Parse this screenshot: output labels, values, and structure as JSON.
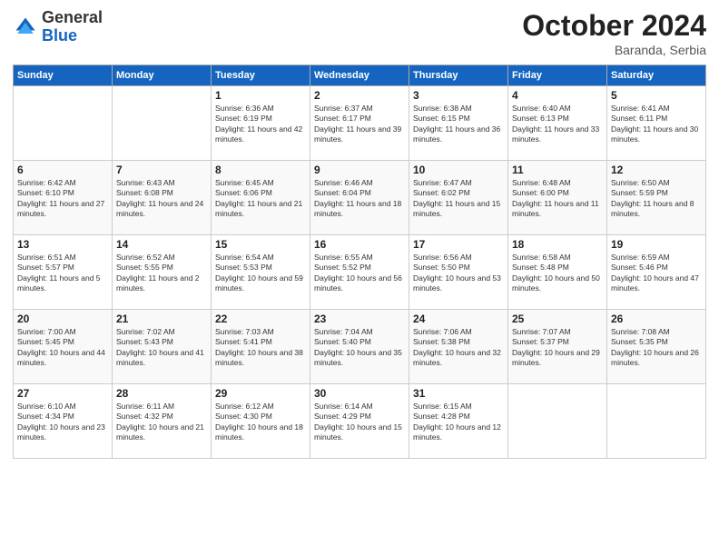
{
  "logo": {
    "general": "General",
    "blue": "Blue"
  },
  "header": {
    "month": "October 2024",
    "location": "Baranda, Serbia"
  },
  "days_of_week": [
    "Sunday",
    "Monday",
    "Tuesday",
    "Wednesday",
    "Thursday",
    "Friday",
    "Saturday"
  ],
  "weeks": [
    [
      {
        "day": "",
        "sunrise": "",
        "sunset": "",
        "daylight": ""
      },
      {
        "day": "",
        "sunrise": "",
        "sunset": "",
        "daylight": ""
      },
      {
        "day": "1",
        "sunrise": "Sunrise: 6:36 AM",
        "sunset": "Sunset: 6:19 PM",
        "daylight": "Daylight: 11 hours and 42 minutes."
      },
      {
        "day": "2",
        "sunrise": "Sunrise: 6:37 AM",
        "sunset": "Sunset: 6:17 PM",
        "daylight": "Daylight: 11 hours and 39 minutes."
      },
      {
        "day": "3",
        "sunrise": "Sunrise: 6:38 AM",
        "sunset": "Sunset: 6:15 PM",
        "daylight": "Daylight: 11 hours and 36 minutes."
      },
      {
        "day": "4",
        "sunrise": "Sunrise: 6:40 AM",
        "sunset": "Sunset: 6:13 PM",
        "daylight": "Daylight: 11 hours and 33 minutes."
      },
      {
        "day": "5",
        "sunrise": "Sunrise: 6:41 AM",
        "sunset": "Sunset: 6:11 PM",
        "daylight": "Daylight: 11 hours and 30 minutes."
      }
    ],
    [
      {
        "day": "6",
        "sunrise": "Sunrise: 6:42 AM",
        "sunset": "Sunset: 6:10 PM",
        "daylight": "Daylight: 11 hours and 27 minutes."
      },
      {
        "day": "7",
        "sunrise": "Sunrise: 6:43 AM",
        "sunset": "Sunset: 6:08 PM",
        "daylight": "Daylight: 11 hours and 24 minutes."
      },
      {
        "day": "8",
        "sunrise": "Sunrise: 6:45 AM",
        "sunset": "Sunset: 6:06 PM",
        "daylight": "Daylight: 11 hours and 21 minutes."
      },
      {
        "day": "9",
        "sunrise": "Sunrise: 6:46 AM",
        "sunset": "Sunset: 6:04 PM",
        "daylight": "Daylight: 11 hours and 18 minutes."
      },
      {
        "day": "10",
        "sunrise": "Sunrise: 6:47 AM",
        "sunset": "Sunset: 6:02 PM",
        "daylight": "Daylight: 11 hours and 15 minutes."
      },
      {
        "day": "11",
        "sunrise": "Sunrise: 6:48 AM",
        "sunset": "Sunset: 6:00 PM",
        "daylight": "Daylight: 11 hours and 11 minutes."
      },
      {
        "day": "12",
        "sunrise": "Sunrise: 6:50 AM",
        "sunset": "Sunset: 5:59 PM",
        "daylight": "Daylight: 11 hours and 8 minutes."
      }
    ],
    [
      {
        "day": "13",
        "sunrise": "Sunrise: 6:51 AM",
        "sunset": "Sunset: 5:57 PM",
        "daylight": "Daylight: 11 hours and 5 minutes."
      },
      {
        "day": "14",
        "sunrise": "Sunrise: 6:52 AM",
        "sunset": "Sunset: 5:55 PM",
        "daylight": "Daylight: 11 hours and 2 minutes."
      },
      {
        "day": "15",
        "sunrise": "Sunrise: 6:54 AM",
        "sunset": "Sunset: 5:53 PM",
        "daylight": "Daylight: 10 hours and 59 minutes."
      },
      {
        "day": "16",
        "sunrise": "Sunrise: 6:55 AM",
        "sunset": "Sunset: 5:52 PM",
        "daylight": "Daylight: 10 hours and 56 minutes."
      },
      {
        "day": "17",
        "sunrise": "Sunrise: 6:56 AM",
        "sunset": "Sunset: 5:50 PM",
        "daylight": "Daylight: 10 hours and 53 minutes."
      },
      {
        "day": "18",
        "sunrise": "Sunrise: 6:58 AM",
        "sunset": "Sunset: 5:48 PM",
        "daylight": "Daylight: 10 hours and 50 minutes."
      },
      {
        "day": "19",
        "sunrise": "Sunrise: 6:59 AM",
        "sunset": "Sunset: 5:46 PM",
        "daylight": "Daylight: 10 hours and 47 minutes."
      }
    ],
    [
      {
        "day": "20",
        "sunrise": "Sunrise: 7:00 AM",
        "sunset": "Sunset: 5:45 PM",
        "daylight": "Daylight: 10 hours and 44 minutes."
      },
      {
        "day": "21",
        "sunrise": "Sunrise: 7:02 AM",
        "sunset": "Sunset: 5:43 PM",
        "daylight": "Daylight: 10 hours and 41 minutes."
      },
      {
        "day": "22",
        "sunrise": "Sunrise: 7:03 AM",
        "sunset": "Sunset: 5:41 PM",
        "daylight": "Daylight: 10 hours and 38 minutes."
      },
      {
        "day": "23",
        "sunrise": "Sunrise: 7:04 AM",
        "sunset": "Sunset: 5:40 PM",
        "daylight": "Daylight: 10 hours and 35 minutes."
      },
      {
        "day": "24",
        "sunrise": "Sunrise: 7:06 AM",
        "sunset": "Sunset: 5:38 PM",
        "daylight": "Daylight: 10 hours and 32 minutes."
      },
      {
        "day": "25",
        "sunrise": "Sunrise: 7:07 AM",
        "sunset": "Sunset: 5:37 PM",
        "daylight": "Daylight: 10 hours and 29 minutes."
      },
      {
        "day": "26",
        "sunrise": "Sunrise: 7:08 AM",
        "sunset": "Sunset: 5:35 PM",
        "daylight": "Daylight: 10 hours and 26 minutes."
      }
    ],
    [
      {
        "day": "27",
        "sunrise": "Sunrise: 6:10 AM",
        "sunset": "Sunset: 4:34 PM",
        "daylight": "Daylight: 10 hours and 23 minutes."
      },
      {
        "day": "28",
        "sunrise": "Sunrise: 6:11 AM",
        "sunset": "Sunset: 4:32 PM",
        "daylight": "Daylight: 10 hours and 21 minutes."
      },
      {
        "day": "29",
        "sunrise": "Sunrise: 6:12 AM",
        "sunset": "Sunset: 4:30 PM",
        "daylight": "Daylight: 10 hours and 18 minutes."
      },
      {
        "day": "30",
        "sunrise": "Sunrise: 6:14 AM",
        "sunset": "Sunset: 4:29 PM",
        "daylight": "Daylight: 10 hours and 15 minutes."
      },
      {
        "day": "31",
        "sunrise": "Sunrise: 6:15 AM",
        "sunset": "Sunset: 4:28 PM",
        "daylight": "Daylight: 10 hours and 12 minutes."
      },
      {
        "day": "",
        "sunrise": "",
        "sunset": "",
        "daylight": ""
      },
      {
        "day": "",
        "sunrise": "",
        "sunset": "",
        "daylight": ""
      }
    ]
  ]
}
